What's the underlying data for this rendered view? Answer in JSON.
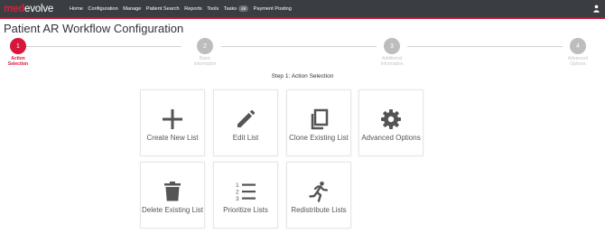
{
  "logo": {
    "part1": "med",
    "part2": "evolve"
  },
  "nav": {
    "items": [
      "Home",
      "Configuration",
      "Manage",
      "Patient Search",
      "Reports",
      "Tools"
    ],
    "tasks_label": "Tasks",
    "tasks_count": "48",
    "payment_posting": "Payment Posting"
  },
  "page_title": "Patient AR Workflow Configuration",
  "stepper": {
    "steps": [
      {
        "number": "1",
        "label": "Action\nSelection",
        "active": true
      },
      {
        "number": "2",
        "label": "Basic\nInformation",
        "active": false
      },
      {
        "number": "3",
        "label": "Additional\nInformation",
        "active": false
      },
      {
        "number": "4",
        "label": "Advanced\nOptions",
        "active": false
      }
    ],
    "heading": "Step 1: Action Selection"
  },
  "tiles": [
    {
      "label": "Create New List",
      "icon": "plus-icon"
    },
    {
      "label": "Edit List",
      "icon": "pencil-icon"
    },
    {
      "label": "Clone Existing List",
      "icon": "clone-icon"
    },
    {
      "label": "Advanced Options",
      "icon": "gear-icon"
    },
    {
      "label": "Delete Existing List",
      "icon": "trash-icon"
    },
    {
      "label": "Prioritize Lists",
      "icon": "ordered-list-icon"
    },
    {
      "label": "Redistribute Lists",
      "icon": "running-person-icon"
    }
  ],
  "colors": {
    "accent": "#d6163a",
    "topbar": "#3a3d42",
    "inactive_step": "#bdbdbd",
    "icon": "#555555"
  }
}
